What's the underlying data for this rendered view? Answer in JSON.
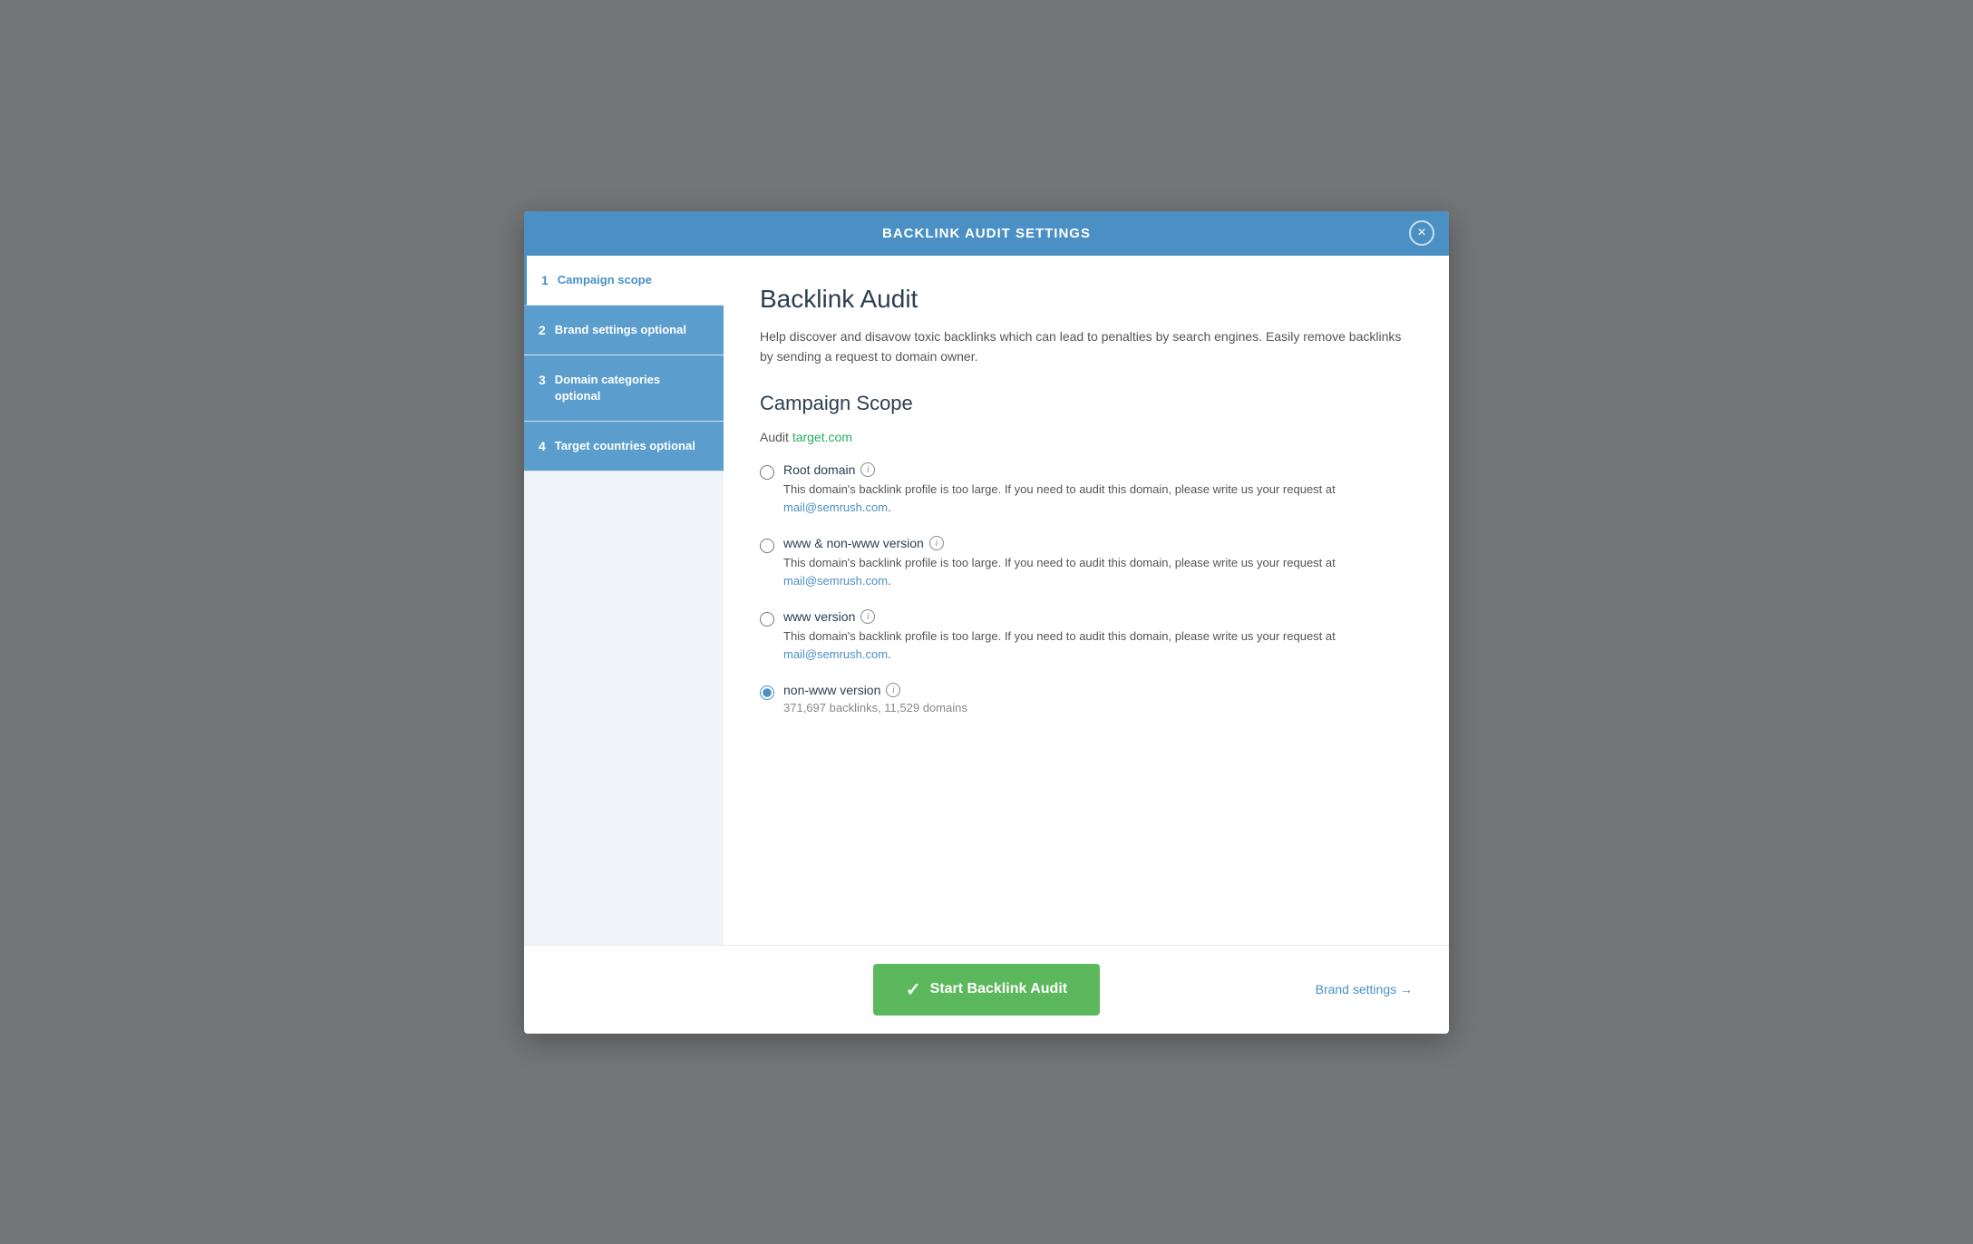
{
  "modal": {
    "header_title": "BACKLINK AUDIT SETTINGS",
    "close_label": "×",
    "content_title": "Backlink Audit",
    "content_desc": "Help discover and disavow toxic backlinks which can lead to penalties by search engines. Easily remove backlinks by sending a request to domain owner.",
    "section_title": "Campaign Scope",
    "audit_prefix": "Audit",
    "audit_domain": "target.com",
    "sidebar": {
      "items": [
        {
          "num": "1",
          "label": "Campaign scope",
          "active": true
        },
        {
          "num": "2",
          "label": "Brand settings optional",
          "active": false
        },
        {
          "num": "3",
          "label": "Domain categories optional",
          "active": false
        },
        {
          "num": "4",
          "label": "Target countries optional",
          "active": false
        }
      ]
    },
    "radio_options": [
      {
        "id": "root-domain",
        "label": "Root domain",
        "desc": "This domain's backlink profile is too large. If you need to audit this domain, please write us your request at",
        "link": "mail@semrush.com",
        "checked": false
      },
      {
        "id": "www-nonwww",
        "label": "www & non-www version",
        "desc": "This domain's backlink profile is too large. If you need to audit this domain, please write us your request at",
        "link": "mail@semrush.com",
        "checked": false
      },
      {
        "id": "www-version",
        "label": "www version",
        "desc": "This domain's backlink profile is too large. If you need to audit this domain, please write us your request at",
        "link": "mail@semrush.com",
        "checked": false
      },
      {
        "id": "non-www-version",
        "label": "non-www version",
        "sub": "371,697 backlinks, 11,529 domains",
        "desc": null,
        "link": null,
        "checked": true
      }
    ],
    "footer": {
      "start_btn_label": "Start Backlink Audit",
      "brand_settings_label": "Brand settings →"
    }
  }
}
